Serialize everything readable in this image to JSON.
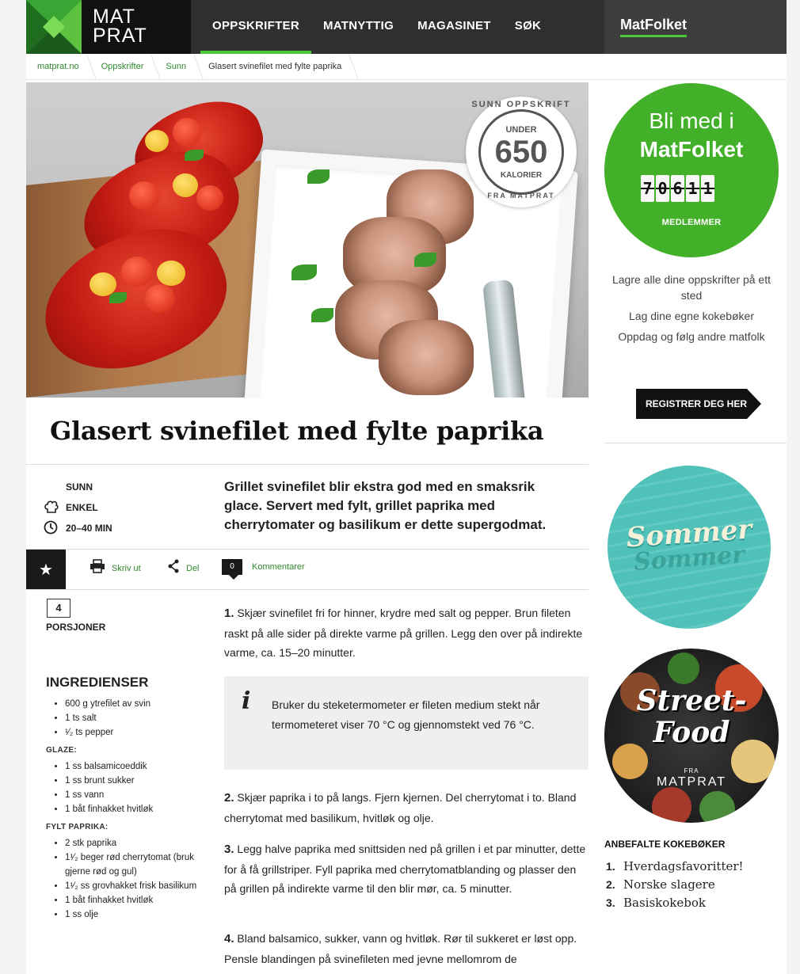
{
  "header": {
    "logo_line1": "MAT",
    "logo_line2": "PRAT",
    "nav": [
      "OPPSKRIFTER",
      "MATNYTTIG",
      "MAGASINET",
      "SØK"
    ],
    "matfolket": "MatFolket"
  },
  "breadcrumb": [
    "matprat.no",
    "Oppskrifter",
    "Sunn",
    "Glasert svinefilet med fylte paprika"
  ],
  "badge": {
    "top": "SUNN OPPSKRIFT",
    "under": "UNDER",
    "number": "650",
    "kalorier": "KALORIER",
    "bottom": "FRA MATPRAT"
  },
  "recipe": {
    "title": "Glasert svinefilet med fylte paprika",
    "meta": {
      "category": "SUNN",
      "difficulty": "ENKEL",
      "time": "20–40 MIN"
    },
    "lead": "Grillet svinefilet blir ekstra god med en smaksrik glace. Servert med fylt, grillet paprika med cherrytomater og basilikum er dette supergodmat.",
    "actions": {
      "print": "Skriv ut",
      "share": "Del",
      "comment_count": "0",
      "comments": "Kommentarer"
    },
    "portions": {
      "value": "4",
      "label": "PORSJONER"
    },
    "ingredients_title": "INGREDIENSER",
    "ingredients_main": [
      "600 g ytrefilet av svin",
      "1 ts salt",
      "¹⁄₂ ts pepper"
    ],
    "glaze_title": "GLAZE:",
    "ingredients_glaze": [
      "1 ss balsamicoeddik",
      "1 ss brunt sukker",
      "1 ss vann",
      "1 båt finhakket hvitløk"
    ],
    "filled_title": "FYLT PAPRIKA:",
    "ingredients_filled": [
      "2 stk paprika",
      "1¹⁄₂ beger rød cherrytomat (bruk gjerne rød og gul)",
      "1¹⁄₂ ss grovhakket frisk basilikum",
      "1 båt finhakket hvitløk",
      "1 ss olje"
    ],
    "steps": [
      {
        "n": "1.",
        "text": "Skjær svinefilet fri for hinner, krydre med salt og pepper. Brun fileten raskt på alle sider på direkte varme på grillen. Legg den over på indirekte varme, ca. 15–20 minutter."
      },
      {
        "n": "2.",
        "text": "Skjær paprika i to på langs. Fjern kjernen. Del cherrytomat i to. Bland cherrytomat med basilikum, hvitløk og olje."
      },
      {
        "n": "3.",
        "text": "Legg halve paprika med snittsiden ned på grillen i et par minutter, dette for å få grillstriper. Fyll paprika med cherrytomatblanding og plasser den på grillen på indirekte varme til den blir mør, ca. 5 minutter."
      },
      {
        "n": "4.",
        "text": "Bland balsamico, sukker, vann og hvitløk. Rør til sukkeret er løst opp. Pensle blandingen på svinefileten med jevne mellomrom de"
      }
    ],
    "tip": "Bruker du steketermometer er fileten medium stekt når termometeret viser 70 °C og gjennomstekt ved 76 °C."
  },
  "sidebar": {
    "join_line1": "Bli med i",
    "join_line2": "MatFolket",
    "member_count": [
      "7",
      "0",
      "6",
      "1",
      "1"
    ],
    "members_label": "MEDLEMMER",
    "perks": [
      "Lagre alle dine oppskrifter på ett sted",
      "Lag dine egne kokebøker",
      "Oppdag og følg andre matfolk"
    ],
    "register_button": "REGISTRER DEG HER",
    "sommer": "Sommer",
    "streetfood_line1": "Street-",
    "streetfood_line2": "Food",
    "streetfood_fra": "FRA",
    "streetfood_brand": "MATPRAT",
    "books_title": "ANBEFALTE KOKEBØKER",
    "books": [
      {
        "n": "1.",
        "name": "Hverdagsfavoritter!"
      },
      {
        "n": "2.",
        "name": "Norske slagere"
      },
      {
        "n": "3.",
        "name": "Basiskokebok"
      }
    ]
  },
  "colors": {
    "brand_green": "#43b02a",
    "link_green": "#2e8a2e",
    "header_dark": "#2f2f2f"
  }
}
